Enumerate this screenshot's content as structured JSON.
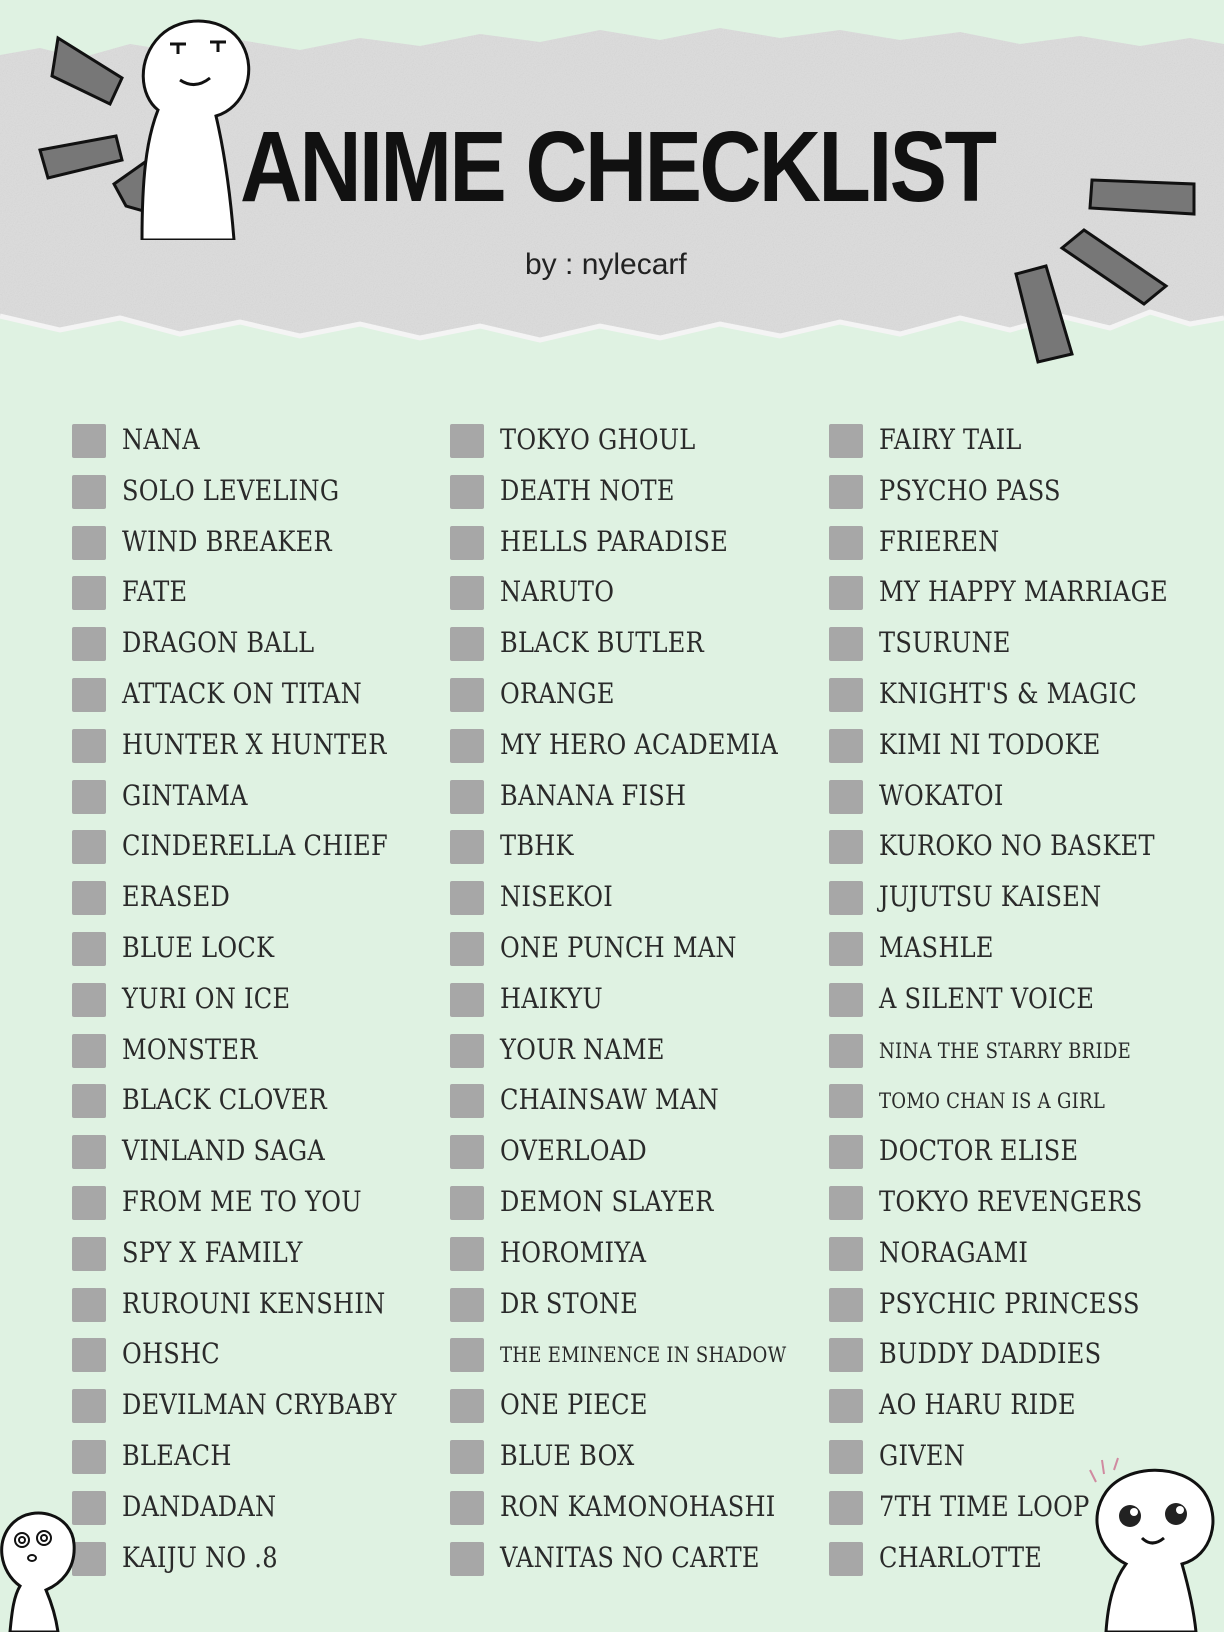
{
  "header": {
    "title": "ANIME CHECKLIST",
    "byline": "by : nylecarf"
  },
  "colors": {
    "background": "#dff2e2",
    "paper": "#dcdcdc",
    "checkbox": "#a7a7a7",
    "text": "#2a2a2a"
  },
  "columns": [
    {
      "items": [
        {
          "label": "Nana"
        },
        {
          "label": "Solo Leveling"
        },
        {
          "label": "Wind Breaker"
        },
        {
          "label": "Fate"
        },
        {
          "label": "Dragon Ball"
        },
        {
          "label": "Attack On Titan"
        },
        {
          "label": "Hunter X Hunter"
        },
        {
          "label": "Gintama"
        },
        {
          "label": "Cinderella Chief"
        },
        {
          "label": "Erased"
        },
        {
          "label": "Blue Lock"
        },
        {
          "label": "Yuri On Ice"
        },
        {
          "label": "Monster"
        },
        {
          "label": "Black Clover"
        },
        {
          "label": "Vinland Saga"
        },
        {
          "label": "From Me To You"
        },
        {
          "label": "Spy X Family"
        },
        {
          "label": "Rurouni Kenshin"
        },
        {
          "label": "OHSHC"
        },
        {
          "label": "Devilman Crybaby"
        },
        {
          "label": "Bleach"
        },
        {
          "label": "Dandadan"
        },
        {
          "label": "Kaiju No .8"
        }
      ]
    },
    {
      "items": [
        {
          "label": "Tokyo Ghoul"
        },
        {
          "label": "Death Note"
        },
        {
          "label": "Hells Paradise"
        },
        {
          "label": "Naruto"
        },
        {
          "label": "Black Butler"
        },
        {
          "label": "Orange"
        },
        {
          "label": "My Hero Academia"
        },
        {
          "label": "Banana Fish"
        },
        {
          "label": "TBHK"
        },
        {
          "label": "Nisekoi"
        },
        {
          "label": "One Punch Man"
        },
        {
          "label": "Haikyu"
        },
        {
          "label": "Your Name"
        },
        {
          "label": "Chainsaw Man"
        },
        {
          "label": "Overload"
        },
        {
          "label": "Demon Slayer"
        },
        {
          "label": "Horomiya"
        },
        {
          "label": "Dr Stone"
        },
        {
          "label": "The Eminence In Shadow"
        },
        {
          "label": "One Piece"
        },
        {
          "label": "Blue Box"
        },
        {
          "label": "Ron Kamonohashi"
        },
        {
          "label": "Vanitas No Carte"
        }
      ]
    },
    {
      "items": [
        {
          "label": "Fairy Tail"
        },
        {
          "label": "Psycho Pass"
        },
        {
          "label": "Frieren"
        },
        {
          "label": "My Happy Marriage"
        },
        {
          "label": "Tsurune"
        },
        {
          "label": "Knight's & Magic"
        },
        {
          "label": "Kimi Ni Todoke"
        },
        {
          "label": "Wokatoi"
        },
        {
          "label": "Kuroko No Basket"
        },
        {
          "label": "Jujutsu Kaisen"
        },
        {
          "label": "Mashle"
        },
        {
          "label": "A Silent Voice"
        },
        {
          "label": "Nina The Starry Bride"
        },
        {
          "label": "Tomo Chan Is A Girl"
        },
        {
          "label": "Doctor Elise"
        },
        {
          "label": "Tokyo Revengers"
        },
        {
          "label": "Noragami"
        },
        {
          "label": "Psychic Princess"
        },
        {
          "label": "Buddy Daddies"
        },
        {
          "label": "Ao Haru Ride"
        },
        {
          "label": "Given"
        },
        {
          "label": "7th Time Loop"
        },
        {
          "label": "Charlotte"
        }
      ]
    }
  ]
}
